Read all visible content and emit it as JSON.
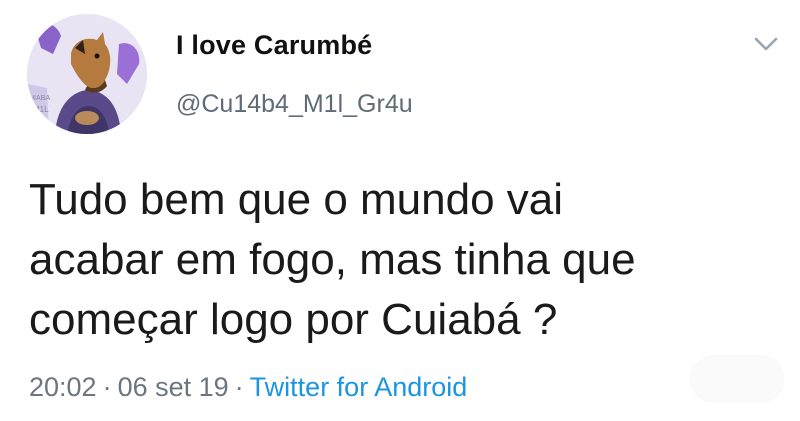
{
  "user": {
    "display_name": "I love Carumbé",
    "handle": "@Cu14b4_M1l_Gr4u",
    "avatar": "horse-mask-avatar"
  },
  "tweet": {
    "lines": [
      "Tudo bem que o mundo vai",
      "acabar em fogo, mas tinha que",
      "começar logo por Cuiabá ?"
    ]
  },
  "meta": {
    "time": "20:02",
    "separator": "·",
    "date": "06 set 19",
    "source": "Twitter for Android"
  },
  "icons": {
    "menu": "chevron-down-icon"
  },
  "colors": {
    "link": "#1b95e0",
    "muted": "#6b7680",
    "text": "#1a1a1a"
  }
}
